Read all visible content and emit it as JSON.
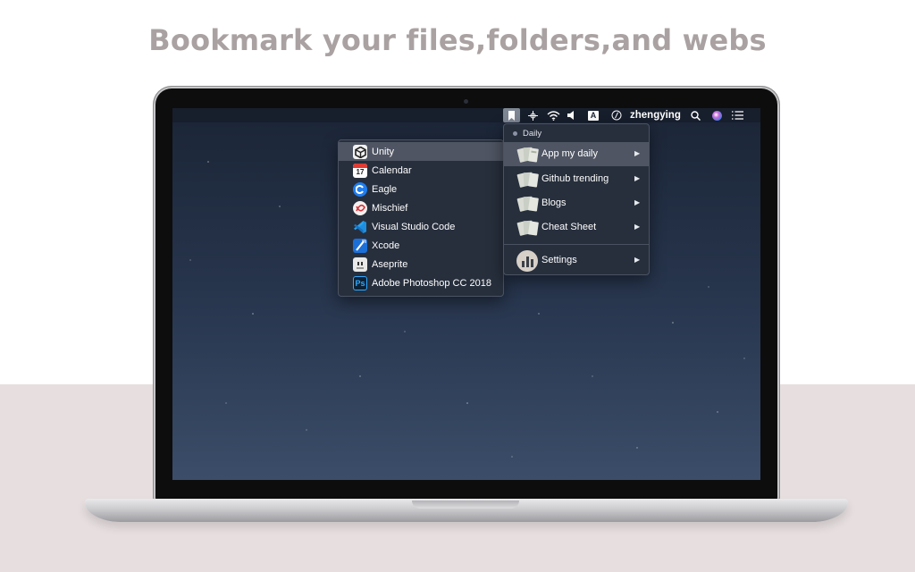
{
  "headline": "Bookmark your files,folders,and webs",
  "colors": {
    "headline": "#aaa2a2",
    "menu_bg": "#282f3c",
    "menu_selected": "#4f5563",
    "desktop": "#27354d"
  },
  "menubar": {
    "username": "zhengying",
    "icons": [
      "bookmark-icon",
      "crosshair-icon",
      "wifi-icon",
      "volume-icon",
      "input-source-icon",
      "scripts-icon",
      "search-icon",
      "siri-icon",
      "notification-list-icon"
    ],
    "input_source": "A"
  },
  "app_menu": {
    "items": [
      {
        "label": "Unity",
        "icon": "unity-icon"
      },
      {
        "label": "Calendar",
        "icon": "calendar-icon",
        "badge": "17"
      },
      {
        "label": "Eagle",
        "icon": "eagle-icon"
      },
      {
        "label": "Mischief",
        "icon": "mischief-icon"
      },
      {
        "label": "Visual Studio Code",
        "icon": "vscode-icon"
      },
      {
        "label": "Xcode",
        "icon": "xcode-icon"
      },
      {
        "label": "Aseprite",
        "icon": "aseprite-icon"
      },
      {
        "label": "Adobe Photoshop CC 2018",
        "icon": "photoshop-icon",
        "badge": "Ps"
      }
    ],
    "selected": "Unity"
  },
  "bookmark_menu": {
    "section": "Daily",
    "items": [
      {
        "label": "App my daily",
        "arrow": "▶"
      },
      {
        "label": "Github trending",
        "arrow": "▶"
      },
      {
        "label": "Blogs",
        "arrow": "▶"
      },
      {
        "label": "Cheat Sheet",
        "arrow": "▶"
      }
    ],
    "settings": {
      "label": "Settings",
      "arrow": "▶"
    },
    "selected": "App my daily"
  }
}
